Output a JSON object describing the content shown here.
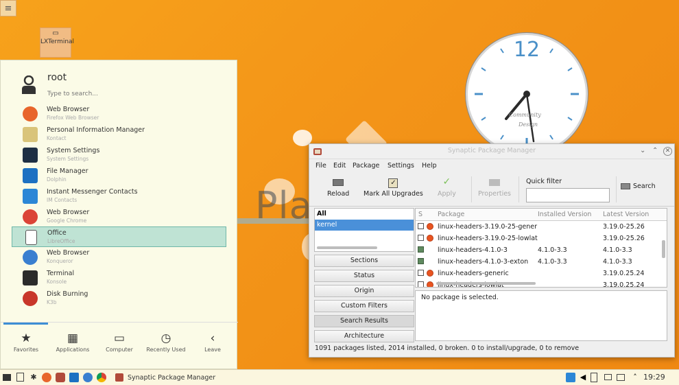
{
  "desktop": {
    "menu_button": "≡",
    "icon_label": "LXTerminal",
    "clock": {
      "number": "12",
      "brand_line1": "Community",
      "brand_line2": "Design"
    },
    "plasma_text": "Pla"
  },
  "launcher": {
    "user": "root",
    "search_placeholder": "Type to search...",
    "apps": [
      {
        "name": "Web Browser",
        "desc": "Firefox Web Browser",
        "icon": "firefox-icon",
        "color": "#e8652b"
      },
      {
        "name": "Personal Information Manager",
        "desc": "Kontact",
        "icon": "kontact-icon",
        "color": "#d9c47a"
      },
      {
        "name": "System Settings",
        "desc": "System Settings",
        "icon": "settings-icon",
        "color": "#1e2f44"
      },
      {
        "name": "File Manager",
        "desc": "Dolphin",
        "icon": "dolphin-icon",
        "color": "#1d71c2"
      },
      {
        "name": "Instant Messenger Contacts",
        "desc": "IM Contacts",
        "icon": "chat-icon",
        "color": "#2c87d6"
      },
      {
        "name": "Web Browser",
        "desc": "Google Chrome",
        "icon": "chrome-icon",
        "color": "#db4437"
      },
      {
        "name": "Office",
        "desc": "LibreOffice",
        "icon": "document-icon",
        "color": "#ffffff"
      },
      {
        "name": "Web Browser",
        "desc": "Konqueror",
        "icon": "konqueror-icon",
        "color": "#3a7fd0"
      },
      {
        "name": "Terminal",
        "desc": "Konsole",
        "icon": "terminal-icon",
        "color": "#2b2b2b"
      },
      {
        "name": "Disk Burning",
        "desc": "K3b",
        "icon": "k3b-icon",
        "color": "#c8372a"
      }
    ],
    "tabs": [
      {
        "label": "Favorites",
        "icon": "star-icon"
      },
      {
        "label": "Applications",
        "icon": "grid-icon"
      },
      {
        "label": "Computer",
        "icon": "computer-icon"
      },
      {
        "label": "Recently Used",
        "icon": "history-icon"
      },
      {
        "label": "Leave",
        "icon": "leave-icon"
      }
    ]
  },
  "synaptic": {
    "title": "Synaptic Package Manager",
    "menu": [
      "File",
      "Edit",
      "Package",
      "Settings",
      "Help"
    ],
    "toolbar": {
      "reload": "Reload",
      "mark_all": "Mark All Upgrades",
      "apply": "Apply",
      "properties": "Properties",
      "quick_filter": "Quick filter",
      "search": "Search"
    },
    "filter_list": [
      "All",
      "kernel"
    ],
    "filter_buttons": [
      "Sections",
      "Status",
      "Origin",
      "Custom Filters",
      "Search Results",
      "Architecture"
    ],
    "columns": {
      "s": "S",
      "package": "Package",
      "installed": "Installed Version",
      "latest": "Latest Version"
    },
    "packages": [
      {
        "name": "linux-headers-3.19.0-25-gener",
        "installed": "",
        "latest": "3.19.0-25.26",
        "state": "ubuntu"
      },
      {
        "name": "linux-headers-3.19.0-25-lowlat",
        "installed": "",
        "latest": "3.19.0-25.26",
        "state": "ubuntu"
      },
      {
        "name": "linux-headers-4.1.0-3",
        "installed": "4.1.0-3.3",
        "latest": "4.1.0-3.3",
        "state": "installed"
      },
      {
        "name": "linux-headers-4.1.0-3-exton",
        "installed": "4.1.0-3.3",
        "latest": "4.1.0-3.3",
        "state": "installed"
      },
      {
        "name": "linux-headers-generic",
        "installed": "",
        "latest": "3.19.0.25.24",
        "state": "ubuntu"
      },
      {
        "name": "linux-headers-lowlat",
        "installed": "",
        "latest": "3.19.0.25.24",
        "state": "ubuntu"
      }
    ],
    "description": "No package is selected.",
    "status": "1091 packages listed, 2014 installed, 0 broken. 0 to install/upgrade, 0 to remove"
  },
  "taskbar": {
    "task_label": "Synaptic Package Manager",
    "time": "19:29"
  }
}
